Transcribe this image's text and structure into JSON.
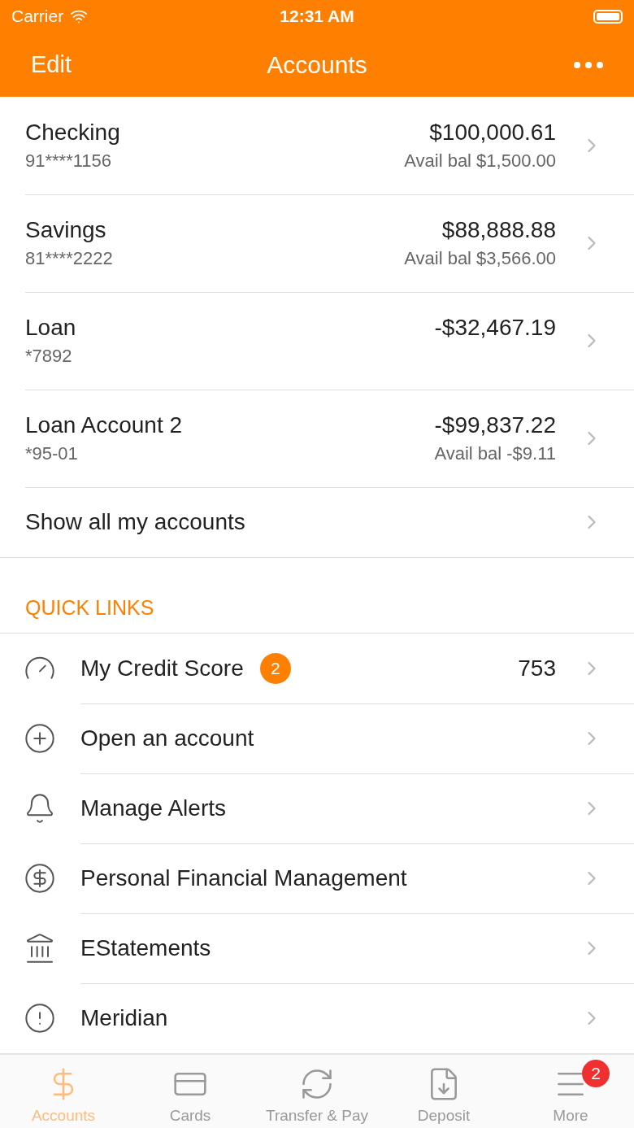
{
  "status_bar": {
    "carrier": "Carrier",
    "time": "12:31 AM"
  },
  "nav_bar": {
    "left": "Edit",
    "title": "Accounts"
  },
  "accounts": [
    {
      "name": "Checking",
      "number": "91****1156",
      "balance": "$100,000.61",
      "available": "Avail bal $1,500.00"
    },
    {
      "name": "Savings",
      "number": "81****2222",
      "balance": "$88,888.88",
      "available": "Avail bal $3,566.00"
    },
    {
      "name": "Loan",
      "number": "*7892",
      "balance": "-$32,467.19"
    },
    {
      "name": "Loan Account 2",
      "number": "*95-01",
      "balance": "-$99,837.22",
      "available": "Avail bal -$9.11"
    }
  ],
  "show_all": "Show all my accounts",
  "quick_links": {
    "title": "QUICK LINKS",
    "items": [
      {
        "kind": "gauge",
        "label": "My Credit Score",
        "badge": "2",
        "value": "753"
      },
      {
        "kind": "open",
        "label": "Open an account"
      },
      {
        "kind": "bell",
        "label": "Manage Alerts"
      },
      {
        "kind": "dollar",
        "label": "Personal Financial Management"
      },
      {
        "kind": "bank",
        "label": "EStatements"
      },
      {
        "kind": "alert",
        "label": "Meridian"
      }
    ]
  },
  "tab_bar": [
    {
      "kind": "accounts",
      "label": "Accounts",
      "selected": true
    },
    {
      "kind": "cards",
      "label": "Cards",
      "selected": false
    },
    {
      "kind": "transfer",
      "label": "Transfer & Pay",
      "selected": false
    },
    {
      "kind": "deposit",
      "label": "Deposit",
      "selected": false
    },
    {
      "kind": "more",
      "label": "More",
      "selected": false,
      "badge": "2"
    }
  ]
}
